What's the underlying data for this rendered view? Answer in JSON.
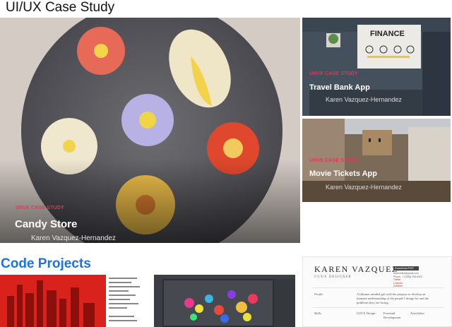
{
  "sections": {
    "uiux_title": "UI/UX Case Study",
    "code_title": "Code Projects"
  },
  "cards": [
    {
      "tag": "UI/UX CASE STUDY",
      "title": "Candy Store",
      "author": "Karen Vazquez-Hernandez"
    },
    {
      "tag": "UI/UX CASE STUDY",
      "title": "Travel Bank App",
      "author": "Karen Vazquez-Hernandez"
    },
    {
      "tag": "UI/UX CASE STUDY",
      "title": "Movie Tickets App",
      "author": "Karen Vazquez-Hernandez"
    }
  ],
  "finance_board": {
    "heading": "FINANCE"
  },
  "resume": {
    "name": "KAREN VAZQUEZ",
    "role": "UI/UX DESIGNER",
    "download": "Download PDF",
    "email": "karenhdez@gmail.com",
    "phone": "Phone: +1 (555) 208-6302",
    "link1": "Twitter",
    "link2": "LinkedIn",
    "link3": "Dribbble",
    "profile_label": "Profile",
    "profile_text": "A filmmer minded girl with the purpose to develop an intimate understanding of the people I design for and the problems they are facing.",
    "skills_label": "Skills",
    "skills": [
      "UI/UX Design",
      "Frontend Development",
      "AutoAdact"
    ]
  },
  "colors": {
    "accent": "#e8335a",
    "link_blue": "#1a73e8"
  }
}
